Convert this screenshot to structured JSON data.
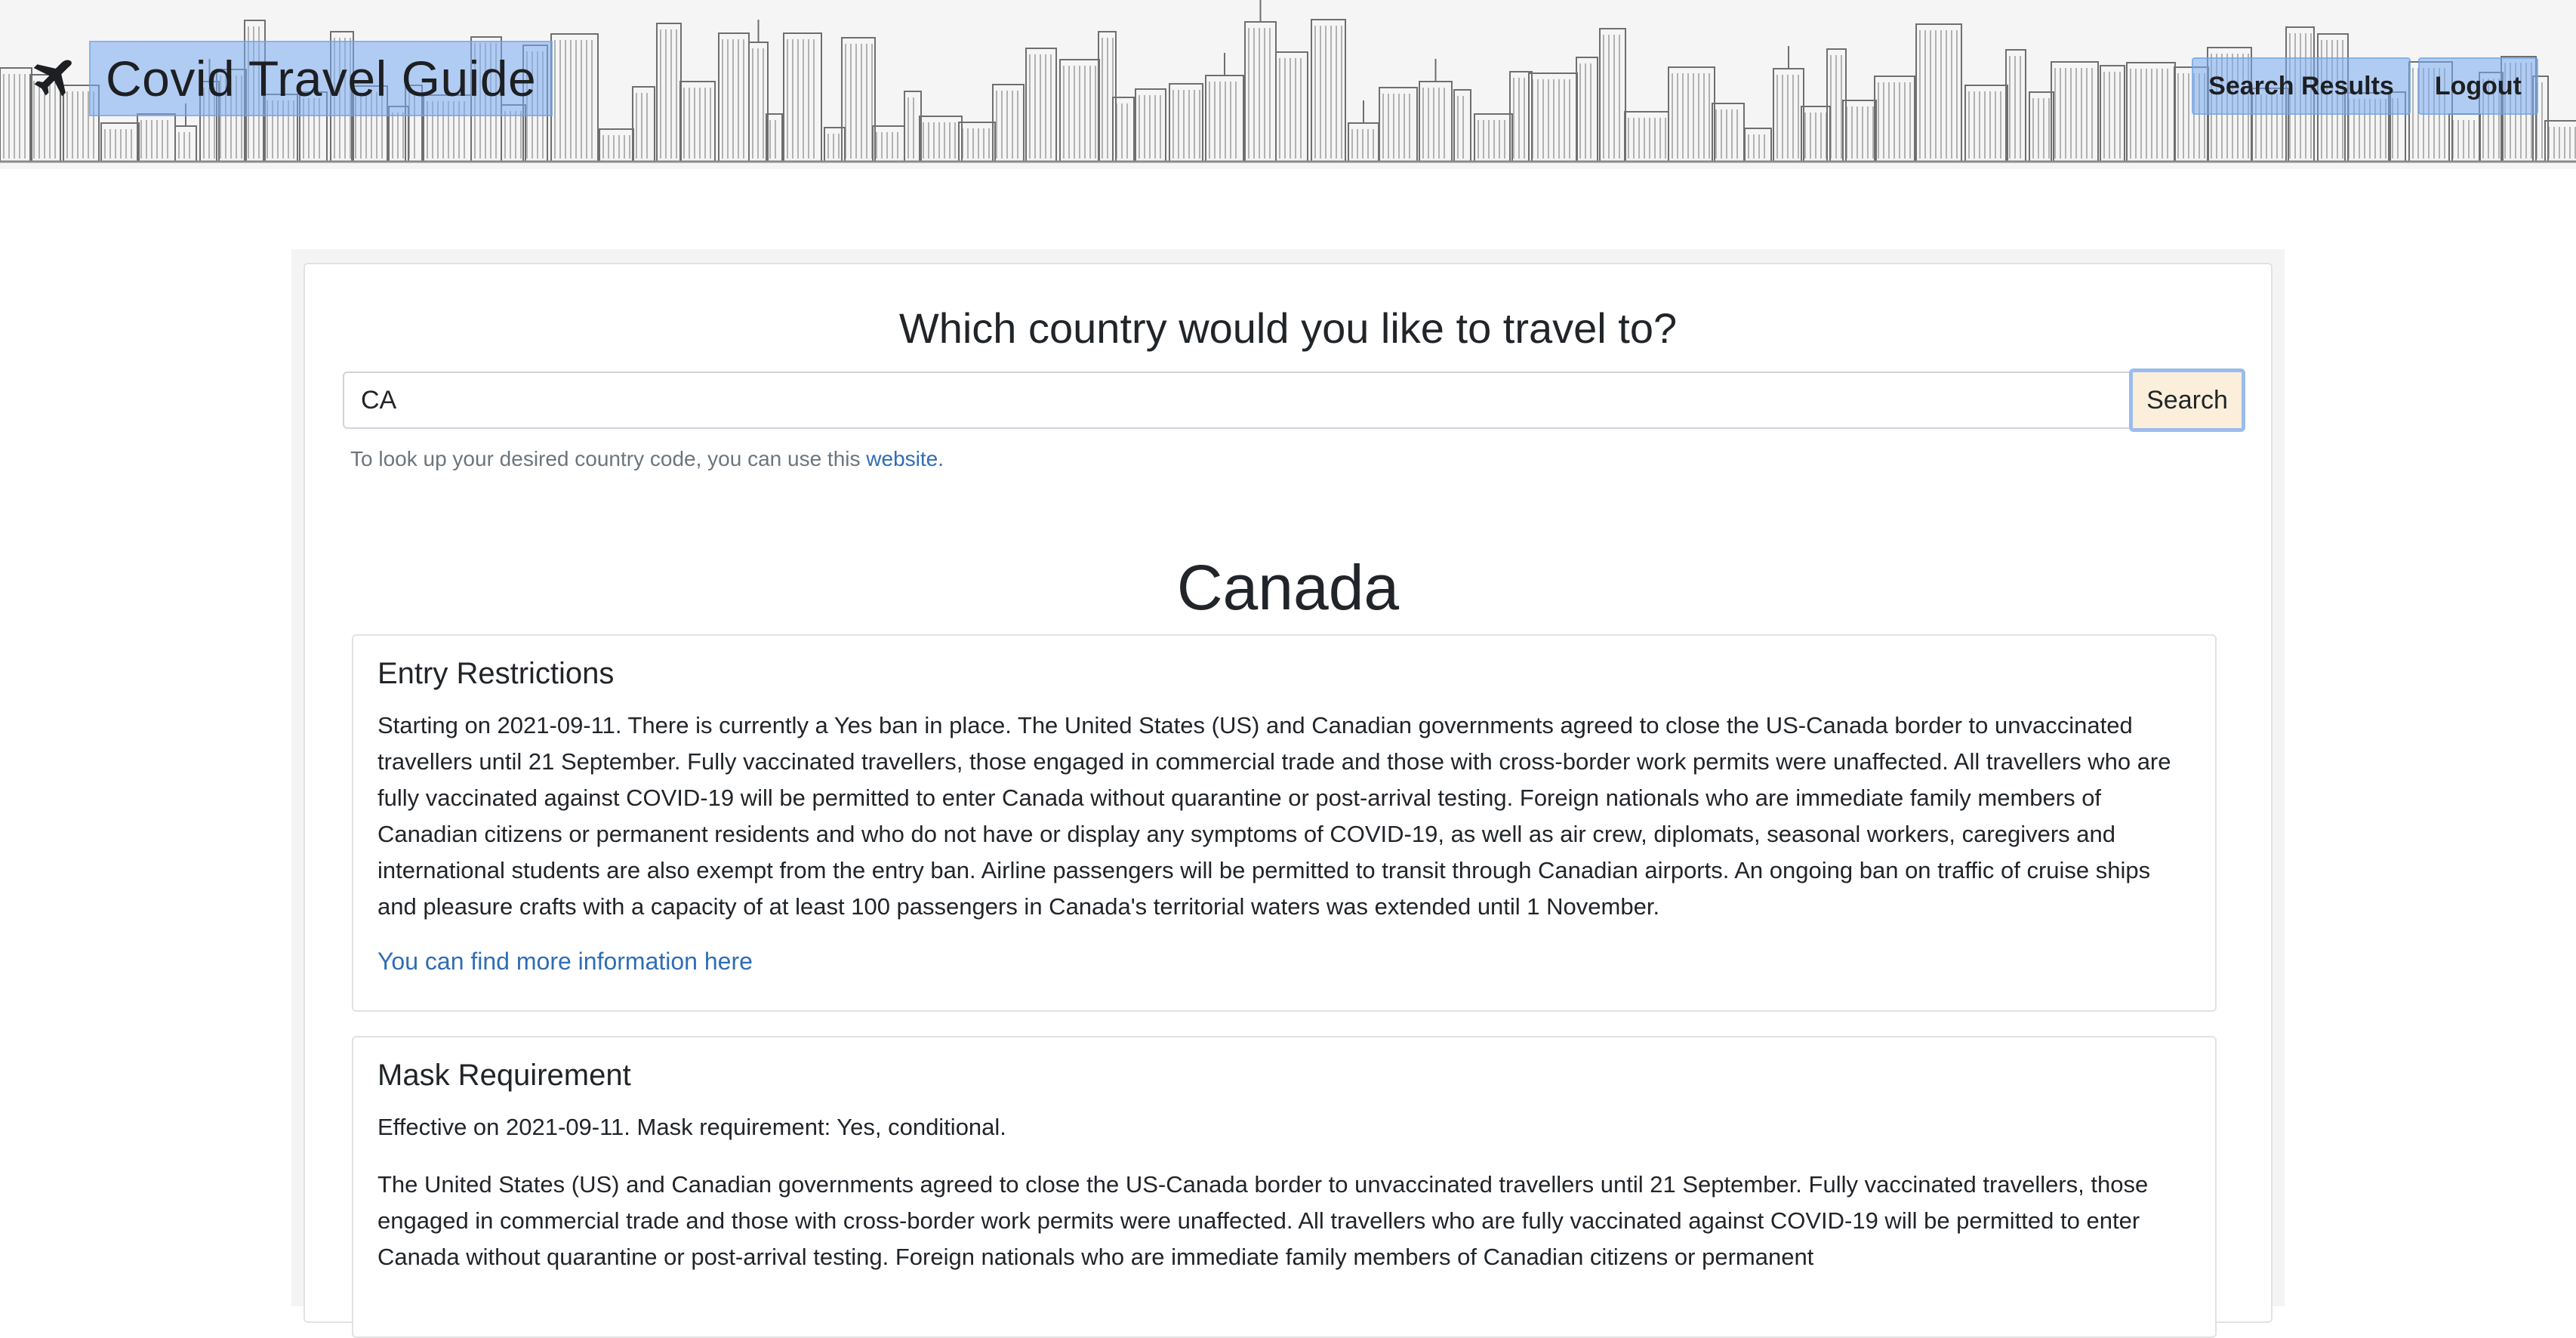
{
  "app": {
    "title": "Covid Travel Guide"
  },
  "nav": {
    "search_results": "Search Results",
    "logout": "Logout"
  },
  "search": {
    "question": "Which country would you like to travel to?",
    "value": "CA",
    "button": "Search",
    "helper_text": "To look up your desired country code, you can use this ",
    "helper_link": "website."
  },
  "result": {
    "country": "Canada",
    "entry_restrictions": {
      "title": "Entry Restrictions",
      "text": "Starting on 2021-09-11. There is currently a Yes ban in place. The United States (US) and Canadian governments agreed to close the US-Canada border to unvaccinated travellers until 21 September. Fully vaccinated travellers, those engaged in commercial trade and those with cross-border work permits were unaffected. All travellers who are fully vaccinated against COVID-19 will be permitted to enter Canada without quarantine or post-arrival testing. Foreign nationals who are immediate family members of Canadian citizens or permanent residents and who do not have or display any symptoms of COVID-19, as well as air crew, diplomats, seasonal workers, caregivers and international students are also exempt from the entry ban. Airline passengers will be permitted to transit through Canadian airports. An ongoing ban on traffic of cruise ships and pleasure crafts with a capacity of at least 100 passengers in Canada's territorial waters was extended until 1 November.",
      "link": "You can find more information here"
    },
    "mask_requirement": {
      "title": "Mask Requirement",
      "summary": "Effective on 2021-09-11. Mask requirement: Yes, conditional.",
      "text": "The United States (US) and Canadian governments agreed to close the US-Canada border to unvaccinated travellers until 21 September. Fully vaccinated travellers, those engaged in commercial trade and those with cross-border work permits were unaffected. All travellers who are fully vaccinated against COVID-19 will be permitted to enter Canada without quarantine or post-arrival testing. Foreign nationals who are immediate family members of Canadian citizens or permanent"
    }
  },
  "colors": {
    "header_bg": "#f5f5f5",
    "highlight": "#9bbcec",
    "link": "#2f6db5",
    "search_button_bg": "#fbefdc"
  },
  "icons": {
    "brand": "airplane-icon",
    "header_art": "city-skyline-illustration"
  }
}
